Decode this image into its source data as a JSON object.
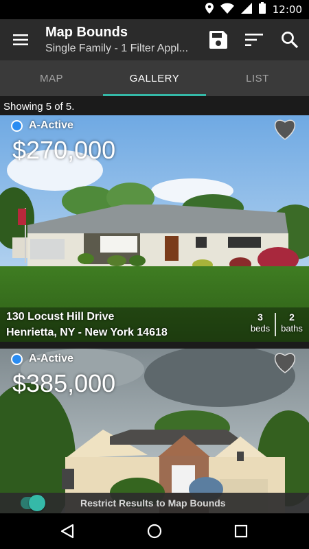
{
  "status_bar": {
    "time": "12:00"
  },
  "toolbar": {
    "title": "Map Bounds",
    "subtitle": "Single Family - 1 Filter Appl...",
    "menu_icon": "hamburger-menu-icon",
    "save_icon": "save-icon",
    "sort_icon": "sort-icon",
    "search_icon": "search-icon"
  },
  "tabs": [
    {
      "label": "MAP",
      "active": false
    },
    {
      "label": "GALLERY",
      "active": true
    },
    {
      "label": "LIST",
      "active": false
    }
  ],
  "results": {
    "showing": "Showing 5 of 5."
  },
  "listings": [
    {
      "status": "A-Active",
      "status_color": "#2a8cf2",
      "price": "$270,000",
      "address": "130 Locust Hill Drive",
      "city": "Henrietta, NY - New York 14618",
      "beds": "3",
      "beds_label": "beds",
      "baths": "2",
      "baths_label": "baths"
    },
    {
      "status": "A-Active",
      "status_color": "#2a8cf2",
      "price": "$385,000"
    }
  ],
  "restrict": {
    "label": "Restrict Results to Map Bounds",
    "enabled": true
  },
  "colors": {
    "accent": "#35b9a8",
    "toolbar": "#2b2b2b",
    "tabs": "#3a3a3a"
  }
}
